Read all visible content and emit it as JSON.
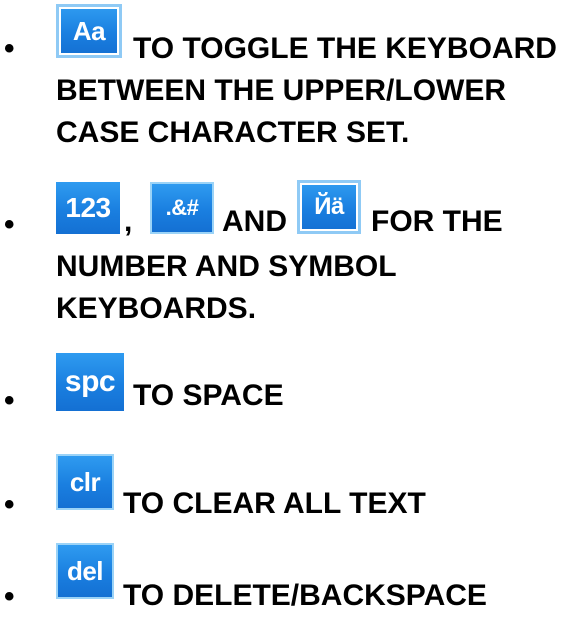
{
  "items": [
    {
      "keys": [
        "Aa"
      ],
      "line1": "TO TOGGLE THE KEYBOARD",
      "line2": "BETWEEN THE UPPER/LOWER",
      "line3": "CASE CHARACTER SET."
    },
    {
      "keys": [
        "123",
        ".&#",
        "Йä"
      ],
      "sep1": ",",
      "sep2": "AND",
      "line1_tail": "FOR THE",
      "line2": "NUMBER AND SYMBOL",
      "line3": "KEYBOARDS."
    },
    {
      "keys": [
        "spc"
      ],
      "line1": "TO SPACE"
    },
    {
      "keys": [
        "clr"
      ],
      "line1": "TO CLEAR ALL TEXT"
    },
    {
      "keys": [
        "del"
      ],
      "line1": "TO DELETE/BACKSPACE"
    }
  ],
  "bullet": "•"
}
